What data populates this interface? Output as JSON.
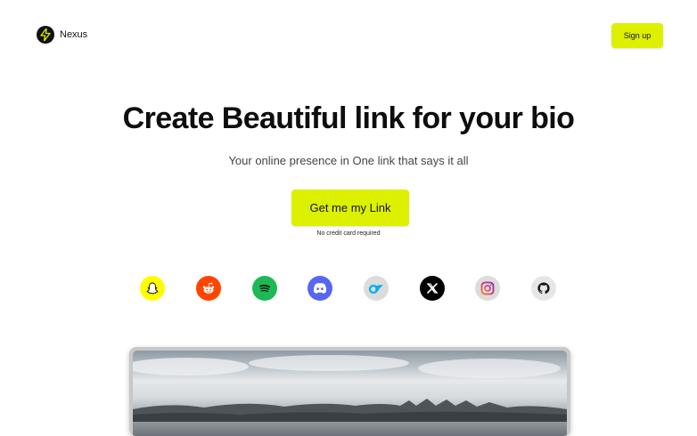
{
  "header": {
    "brand": "Nexus",
    "logo_icon": "lightning-bolt-icon",
    "signup_label": "Sign up"
  },
  "hero": {
    "title": "Create Beautiful link for your bio",
    "subtitle": "Your online presence in One link that says it all",
    "cta_label": "Get me my Link",
    "cta_note": "No credit card required"
  },
  "social_icons": [
    {
      "name": "snapchat-icon",
      "color": "#fffc00"
    },
    {
      "name": "reddit-icon",
      "color": "#ff4500"
    },
    {
      "name": "spotify-icon",
      "color": "#1db954"
    },
    {
      "name": "discord-icon",
      "color": "#5865f2"
    },
    {
      "name": "onlyfans-icon",
      "color": "#00aff0"
    },
    {
      "name": "x-icon",
      "color": "#000000"
    },
    {
      "name": "instagram-icon",
      "color": "#e1306c"
    },
    {
      "name": "github-icon",
      "color": "#181717"
    }
  ],
  "colors": {
    "accent": "#dcf000",
    "text": "#111111",
    "background": "#ffffff"
  },
  "preview": {
    "image": "landscape-photo"
  }
}
